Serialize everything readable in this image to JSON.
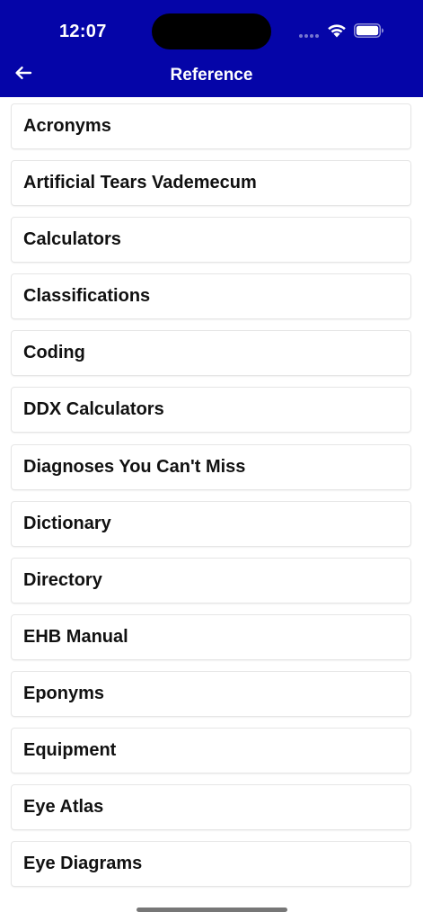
{
  "status_bar": {
    "time": "12:07"
  },
  "header": {
    "title": "Reference",
    "back_icon": "arrow-left-icon",
    "background_color": "#0505a8"
  },
  "reference_items": [
    {
      "label": "Acronyms"
    },
    {
      "label": "Artificial Tears Vademecum"
    },
    {
      "label": "Calculators"
    },
    {
      "label": "Classifications"
    },
    {
      "label": "Coding"
    },
    {
      "label": "DDX Calculators"
    },
    {
      "label": "Diagnoses You Can't Miss"
    },
    {
      "label": "Dictionary"
    },
    {
      "label": "Directory"
    },
    {
      "label": "EHB Manual"
    },
    {
      "label": "Eponyms"
    },
    {
      "label": "Equipment"
    },
    {
      "label": "Eye Atlas"
    },
    {
      "label": "Eye Diagrams"
    }
  ]
}
